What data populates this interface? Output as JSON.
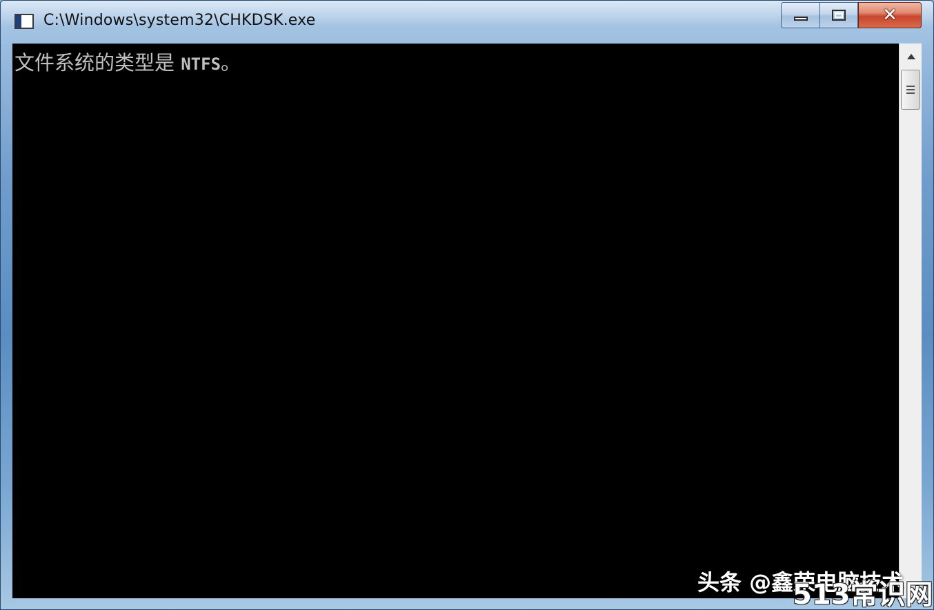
{
  "window": {
    "title": "C:\\Windows\\system32\\CHKDSK.exe"
  },
  "console": {
    "lines": [
      {
        "text_cjk": "文件系统的类型是",
        "text_mono": "NTFS",
        "suffix": "。"
      }
    ]
  },
  "caption_buttons": {
    "close_label": "✕"
  },
  "watermarks": {
    "source": "头条 @鑫荣电脑技术",
    "site": "513常识网"
  },
  "colors": {
    "console_background": "#000000",
    "console_text": "#c0c0c0",
    "close_button": "#c9452c"
  },
  "icons": {
    "title_icon": "console-window-icon",
    "minimize": "minimize-icon",
    "maximize": "maximize-icon",
    "close": "close-icon",
    "scroll_up": "scroll-up-arrow-icon"
  }
}
